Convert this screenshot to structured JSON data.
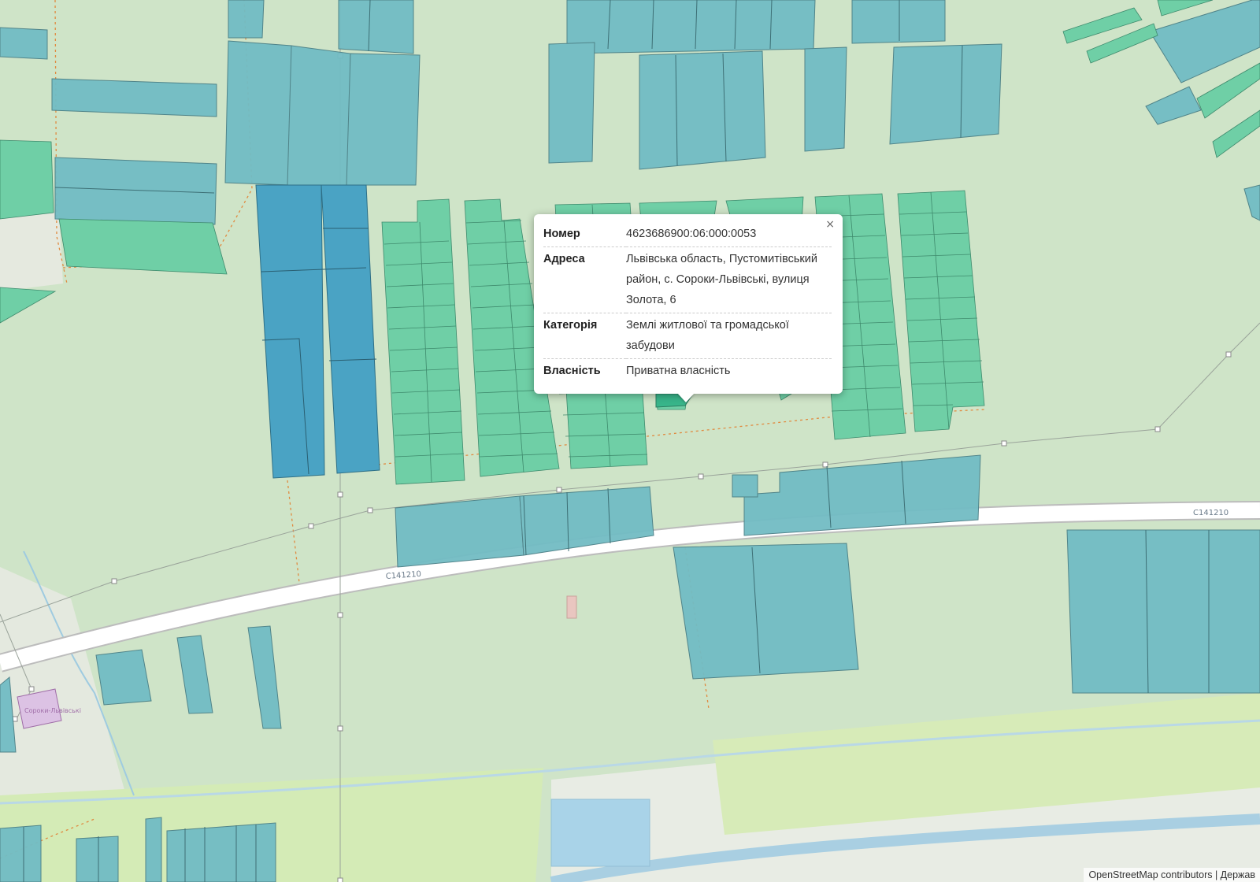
{
  "map": {
    "road_labels": [
      "C141210",
      "C141210"
    ],
    "place_label": "Сороки-Львівські"
  },
  "popup": {
    "close_symbol": "×",
    "rows": [
      {
        "key": "Номер",
        "value": "4623686900:06:000:0053"
      },
      {
        "key": "Адреса",
        "value": "Львівська область, Пустомитівський район, с. Сороки-Львівські, вулиця Золота, 6"
      },
      {
        "key": "Категорія",
        "value": "Землі житлової та громадської забудови"
      },
      {
        "key": "Власність",
        "value": "Приватна власність"
      }
    ]
  },
  "attribution": "OpenStreetMap contributors | Держав",
  "colors": {
    "background": "#cfe4c8",
    "parcel_blue": "#72bcc4",
    "parcel_dark": "#4aa3c4",
    "parcel_green": "#6fcfa6",
    "road": "#ffffff",
    "water": "#a9cfe2"
  }
}
